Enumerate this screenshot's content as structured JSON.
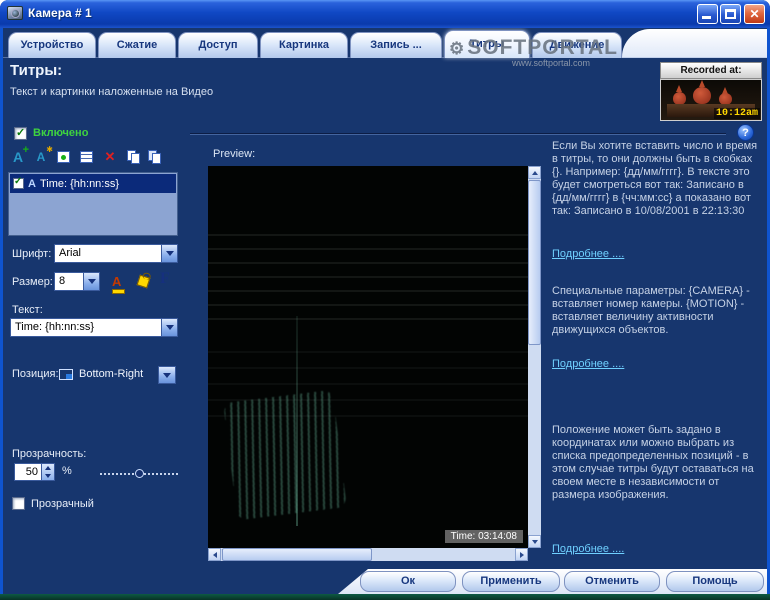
{
  "window": {
    "title": "Камера # 1"
  },
  "tabs": {
    "items": [
      {
        "label": "Устройство",
        "active": false
      },
      {
        "label": "Сжатие",
        "active": false
      },
      {
        "label": "Доступ",
        "active": false
      },
      {
        "label": "Картинка",
        "active": false
      },
      {
        "label": "Запись ...",
        "active": false
      },
      {
        "label": "Титры",
        "active": true
      },
      {
        "label": "Движение",
        "active": false
      }
    ]
  },
  "watermark": {
    "name": "SOFTPORTAL",
    "url": "www.softportal.com"
  },
  "header": {
    "title": "Титры:",
    "subtitle": "Текст и картинки наложенные на Видео"
  },
  "recorded": {
    "label": "Recorded at:",
    "time": "10:12am"
  },
  "enabled_checkbox": {
    "label": "Включено",
    "checked": true
  },
  "titles_list": {
    "items": [
      {
        "checked": true,
        "label": "Time: {hh:nn:ss}"
      }
    ]
  },
  "font": {
    "label": "Шрифт:",
    "value": "Arial"
  },
  "size": {
    "label": "Размер:",
    "value": "8"
  },
  "text": {
    "label": "Текст:",
    "value": "Time: {hh:nn:ss}"
  },
  "position": {
    "label": "Позиция:",
    "value": "Bottom-Right"
  },
  "transparency": {
    "label": "Прозрачность:",
    "value": "50",
    "unit": "%"
  },
  "transparent_checkbox": {
    "label": "Прозрачный",
    "checked": false
  },
  "preview": {
    "label": "Preview:",
    "time_overlay": "Time: 03:14:08"
  },
  "help": {
    "sections": [
      {
        "text": "Если Вы хотите вставить число и время в титры, то они должны быть в скобках {}. Например: {дд/мм/гггг}. В тексте это будет смотреться вот так: Записано в {дд/мм/гггг} в {чч:мм:сс} а показано вот так: Записано в 10/08/2001 в 22:13:30",
        "link": "Подробнее ...."
      },
      {
        "text": "Специальные параметры: {CAMERA} - вставляет номер камеры. {MOTION} - вставляет величину активности движущихся объектов.",
        "link": "Подробнее ...."
      },
      {
        "text": "Положение может быть задано в координатах или можно выбрать из списка предопределенных позиций - в этом случае титры будут оставаться на своем месте в независимости от размера изображения.",
        "link": "Подробнее ...."
      }
    ]
  },
  "footer": {
    "buttons": [
      {
        "label": "Ок"
      },
      {
        "label": "Применить"
      },
      {
        "label": "Отменить"
      },
      {
        "label": "Помощь"
      }
    ]
  },
  "icons": {
    "check": "✓",
    "help": "?",
    "add_text": "A",
    "add_field": "A",
    "delete": "✕",
    "font_color": "A",
    "bold_f": "F",
    "item_a": "A"
  },
  "colors": {
    "background": "#17366e",
    "titlebar_blue": "#0f54d0",
    "link": "#6fd0ff",
    "enabled_green": "#3fd43f",
    "time_yellow": "#ffd800",
    "bottom_strip_green": "#0e5a44"
  }
}
